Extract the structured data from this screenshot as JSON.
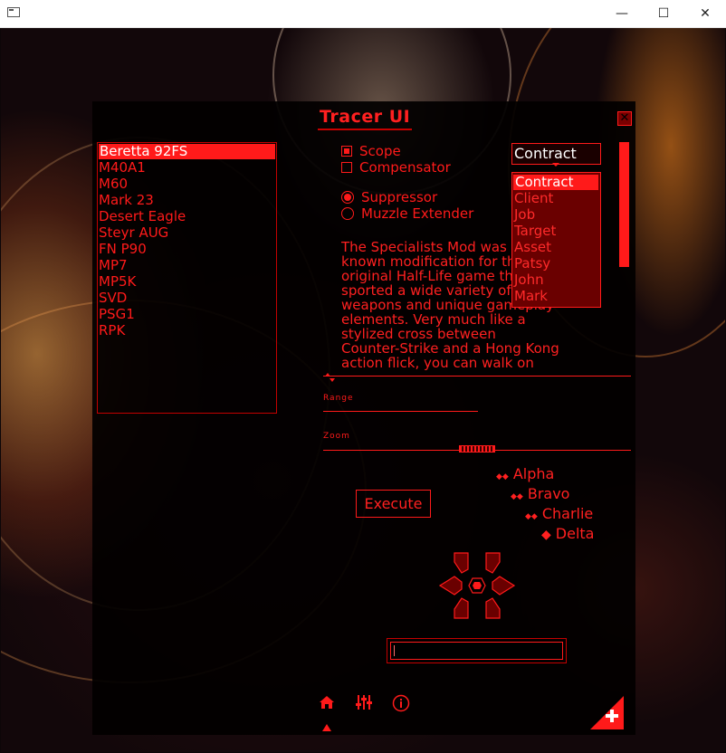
{
  "window": {
    "min_glyph": "—",
    "max_glyph": "☐",
    "close_glyph": "✕"
  },
  "panel": {
    "title": "Tracer UI",
    "close_glyph": "✕"
  },
  "weapons": {
    "selected_index": 0,
    "items": [
      "Beretta 92FS",
      "M40A1",
      "M60",
      "Mark 23",
      "Desert Eagle",
      "Steyr AUG",
      "FN P90",
      "MP7",
      "MP5K",
      "SVD",
      "PSG1",
      "RPK"
    ]
  },
  "checkboxes": [
    {
      "label": "Scope",
      "checked": true
    },
    {
      "label": "Compensator",
      "checked": false
    }
  ],
  "radios": [
    {
      "label": "Suppressor",
      "selected": true
    },
    {
      "label": "Muzzle Extender",
      "selected": false
    }
  ],
  "dropdown": {
    "value": "Contract",
    "options": [
      "Contract",
      "Client",
      "Job",
      "Target",
      "Asset",
      "Patsy",
      "John",
      "Mark"
    ]
  },
  "description": {
    "lines": [
      "The Specialists Mod was a well-",
      "known modification for the",
      "original Half-Life game that",
      "sported a wide variety of",
      "weapons and unique gameplay",
      "elements. Very much like a",
      "stylized cross between",
      "Counter-Strike and a Hong Kong",
      "action flick, you can walk on"
    ]
  },
  "sliders": {
    "range": {
      "label": "Range",
      "value": 0
    },
    "zoom": {
      "label": "Zoom",
      "value": 0.56
    }
  },
  "tree": {
    "items": [
      "Alpha",
      "Bravo",
      "Charlie",
      "Delta"
    ]
  },
  "execute": {
    "label": "Execute"
  },
  "input": {
    "value": ""
  },
  "colors": {
    "accent": "#ff1a1a",
    "panel_bg": "#020000",
    "list_bg": "#6a0000"
  },
  "icons": {
    "nav": [
      "home-icon",
      "sliders-icon",
      "info-icon"
    ],
    "corner": "plus-icon"
  }
}
